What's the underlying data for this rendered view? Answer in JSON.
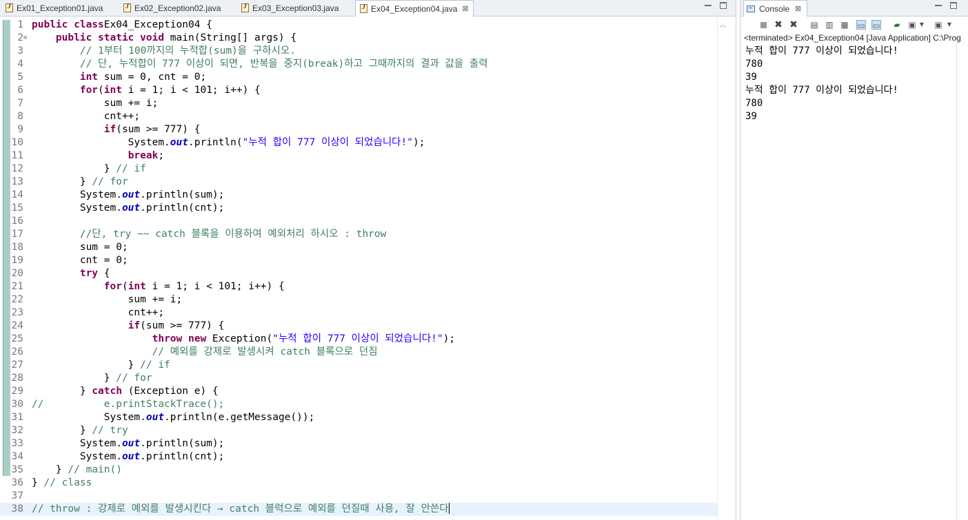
{
  "editor": {
    "tabs": [
      {
        "label": "Ex01_Exception01.java"
      },
      {
        "label": "Ex02_Exception02.java"
      },
      {
        "label": "Ex03_Exception03.java"
      },
      {
        "label": "Ex04_Exception04.java",
        "active": true,
        "close": "⊠"
      }
    ],
    "lines": [
      {
        "n": "1",
        "tokens": [
          [
            "kw",
            "public class"
          ],
          [
            "",
            "Ex04_Exception04 {"
          ]
        ]
      },
      {
        "n": "2",
        "fold": "⊖",
        "tokens": [
          [
            "",
            "    "
          ],
          [
            "kw",
            "public static void"
          ],
          [
            "",
            " main(String[] args) {"
          ]
        ]
      },
      {
        "n": "3",
        "tokens": [
          [
            "",
            "        "
          ],
          [
            "cm",
            "// 1부터 100까지의 누적합(sum)을 구하시오."
          ]
        ]
      },
      {
        "n": "4",
        "tokens": [
          [
            "",
            "        "
          ],
          [
            "cm",
            "// 단, 누적합이 777 이상이 되면, 반복을 중지(break)하고 그때까지의 결과 값을 출력"
          ]
        ]
      },
      {
        "n": "5",
        "tokens": [
          [
            "",
            "        "
          ],
          [
            "kw",
            "int"
          ],
          [
            "",
            " sum = 0, cnt = 0;"
          ]
        ]
      },
      {
        "n": "6",
        "tokens": [
          [
            "",
            "        "
          ],
          [
            "kw",
            "for"
          ],
          [
            "",
            "("
          ],
          [
            "kw",
            "int"
          ],
          [
            "",
            " i = 1; i < 101; i++) {"
          ]
        ]
      },
      {
        "n": "7",
        "tokens": [
          [
            "",
            "            sum += i;"
          ]
        ]
      },
      {
        "n": "8",
        "tokens": [
          [
            "",
            "            cnt++;"
          ]
        ]
      },
      {
        "n": "9",
        "tokens": [
          [
            "",
            "            "
          ],
          [
            "kw",
            "if"
          ],
          [
            "",
            "(sum >= 777) {"
          ]
        ]
      },
      {
        "n": "10",
        "tokens": [
          [
            "",
            "                System."
          ],
          [
            "fld",
            "out"
          ],
          [
            "",
            ".println("
          ],
          [
            "str",
            "\"누적 합이 777 이상이 되었습니다!\""
          ],
          [
            "",
            ");"
          ]
        ]
      },
      {
        "n": "11",
        "tokens": [
          [
            "",
            "                "
          ],
          [
            "kw",
            "break"
          ],
          [
            "",
            ";"
          ]
        ]
      },
      {
        "n": "12",
        "tokens": [
          [
            "",
            "            } "
          ],
          [
            "cm",
            "// if"
          ]
        ]
      },
      {
        "n": "13",
        "tokens": [
          [
            "",
            "        } "
          ],
          [
            "cm",
            "// for"
          ]
        ]
      },
      {
        "n": "14",
        "tokens": [
          [
            "",
            "        System."
          ],
          [
            "fld",
            "out"
          ],
          [
            "",
            ".println(sum);"
          ]
        ]
      },
      {
        "n": "15",
        "tokens": [
          [
            "",
            "        System."
          ],
          [
            "fld",
            "out"
          ],
          [
            "",
            ".println(cnt);"
          ]
        ]
      },
      {
        "n": "16",
        "tokens": [
          [
            "",
            ""
          ]
        ]
      },
      {
        "n": "17",
        "tokens": [
          [
            "",
            "        "
          ],
          [
            "cm",
            "//단, try ~~ catch 블록을 이용하여 예외처리 하시오 : throw"
          ]
        ]
      },
      {
        "n": "18",
        "tokens": [
          [
            "",
            "        sum = 0;"
          ]
        ]
      },
      {
        "n": "19",
        "tokens": [
          [
            "",
            "        cnt = 0;"
          ]
        ]
      },
      {
        "n": "20",
        "tokens": [
          [
            "",
            "        "
          ],
          [
            "kw",
            "try"
          ],
          [
            "",
            " {"
          ]
        ]
      },
      {
        "n": "21",
        "tokens": [
          [
            "",
            "            "
          ],
          [
            "kw",
            "for"
          ],
          [
            "",
            "("
          ],
          [
            "kw",
            "int"
          ],
          [
            "",
            " i = 1; i < 101; i++) {"
          ]
        ]
      },
      {
        "n": "22",
        "tokens": [
          [
            "",
            "                sum += i;"
          ]
        ]
      },
      {
        "n": "23",
        "tokens": [
          [
            "",
            "                cnt++;"
          ]
        ]
      },
      {
        "n": "24",
        "tokens": [
          [
            "",
            "                "
          ],
          [
            "kw",
            "if"
          ],
          [
            "",
            "(sum >= 777) {"
          ]
        ]
      },
      {
        "n": "25",
        "tokens": [
          [
            "",
            "                    "
          ],
          [
            "kw",
            "throw new"
          ],
          [
            "",
            " Exception("
          ],
          [
            "str",
            "\"누적 합이 777 이상이 되었습니다!\""
          ],
          [
            "",
            ");"
          ]
        ]
      },
      {
        "n": "26",
        "tokens": [
          [
            "",
            "                    "
          ],
          [
            "cm",
            "// 예외를 강제로 발생시켜 catch 블록으로 던짐"
          ]
        ]
      },
      {
        "n": "27",
        "tokens": [
          [
            "",
            "                } "
          ],
          [
            "cm",
            "// if"
          ]
        ]
      },
      {
        "n": "28",
        "tokens": [
          [
            "",
            "            } "
          ],
          [
            "cm",
            "// for"
          ]
        ]
      },
      {
        "n": "29",
        "tokens": [
          [
            "",
            "        } "
          ],
          [
            "kw",
            "catch"
          ],
          [
            "",
            " (Exception e) {"
          ]
        ]
      },
      {
        "n": "30",
        "tokens": [
          [
            "cm",
            "//          e.printStackTrace();"
          ]
        ]
      },
      {
        "n": "31",
        "tokens": [
          [
            "",
            "            System."
          ],
          [
            "fld",
            "out"
          ],
          [
            "",
            ".println(e.getMessage());"
          ]
        ]
      },
      {
        "n": "32",
        "tokens": [
          [
            "",
            "        } "
          ],
          [
            "cm",
            "// try"
          ]
        ]
      },
      {
        "n": "33",
        "tokens": [
          [
            "",
            "        System."
          ],
          [
            "fld",
            "out"
          ],
          [
            "",
            ".println(sum);"
          ]
        ]
      },
      {
        "n": "34",
        "tokens": [
          [
            "",
            "        System."
          ],
          [
            "fld",
            "out"
          ],
          [
            "",
            ".println(cnt);"
          ]
        ]
      },
      {
        "n": "35",
        "tokens": [
          [
            "",
            "    } "
          ],
          [
            "cm",
            "// main()"
          ]
        ]
      },
      {
        "n": "36",
        "tokens": [
          [
            "",
            "} "
          ],
          [
            "cm",
            "// class"
          ]
        ]
      },
      {
        "n": "37",
        "tokens": [
          [
            "",
            ""
          ]
        ]
      },
      {
        "n": "38",
        "current": true,
        "tokens": [
          [
            "cm",
            "// throw : 강제로 예외를 발생시킨다 → catch 블럭으로 예외를 던질때 사용, 잘 안쓴다"
          ]
        ]
      }
    ]
  },
  "console": {
    "tab_label": "Console",
    "tab_close": "⊠",
    "status": "<terminated> Ex04_Exception04 [Java Application] C:\\Prog",
    "output": [
      "누적 합이 777 이상이 되었습니다!",
      "780",
      "39",
      "누적 합이 777 이상이 되었습니다!",
      "780",
      "39"
    ]
  },
  "colors": {
    "keyword": "#7f0055",
    "comment": "#3f7f5f",
    "string": "#2a00ff",
    "field": "#0000c0",
    "current_line": "#e8f2fe"
  }
}
